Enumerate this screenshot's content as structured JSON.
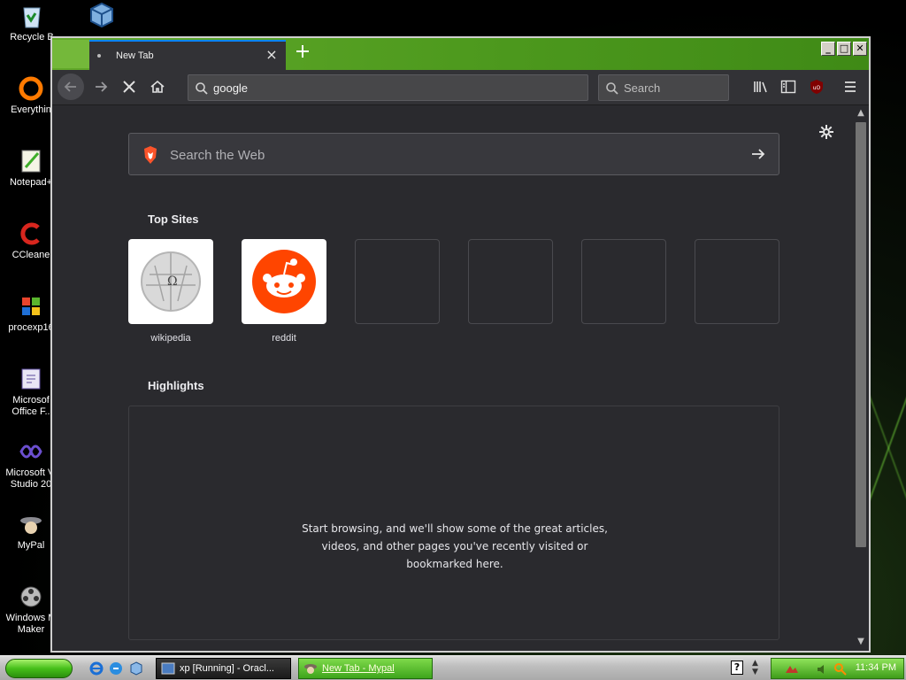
{
  "desktop": {
    "icons": [
      {
        "label": "Recycle B",
        "icon": "recycle-bin-icon"
      },
      {
        "label": "Everythin",
        "icon": "everything-icon"
      },
      {
        "label": "Notepad+",
        "icon": "notepad-plus-icon"
      },
      {
        "label": "CCleane",
        "icon": "ccleaner-icon"
      },
      {
        "label": "procexp16",
        "icon": "process-explorer-icon"
      },
      {
        "label": "Microsof Office F..",
        "icon": "office-icon"
      },
      {
        "label": "Microsoft Vi Studio 20",
        "icon": "visual-studio-icon"
      },
      {
        "label": "MyPal",
        "icon": "mypal-icon"
      },
      {
        "label": "Windows M Maker",
        "icon": "movie-maker-icon"
      }
    ]
  },
  "browser": {
    "tab": {
      "title": "New Tab"
    },
    "window_buttons": {
      "minimize": "_",
      "maximize": "□",
      "close": "✕"
    },
    "urlbar": {
      "value": "google"
    },
    "searchbar": {
      "placeholder": "Search"
    },
    "ublock_label": "uO"
  },
  "newtab": {
    "search_placeholder": "Search the Web",
    "top_sites_title": "Top Sites",
    "top_sites": [
      {
        "label": "wikipedia",
        "icon": "wikipedia-icon"
      },
      {
        "label": "reddit",
        "icon": "reddit-icon"
      },
      {
        "label": ""
      },
      {
        "label": ""
      },
      {
        "label": ""
      },
      {
        "label": ""
      }
    ],
    "highlights_title": "Highlights",
    "highlights_message_1": "Start browsing, and we'll show some of the great articles,",
    "highlights_message_2": "videos, and other pages you've recently visited or",
    "highlights_message_3": "bookmarked here."
  },
  "taskbar": {
    "tasks": [
      {
        "label": "xp [Running] - Oracl..."
      },
      {
        "label": "New Tab - Mypal"
      }
    ],
    "clock": "11:34 PM"
  },
  "colors": {
    "accent": "#0a84ff",
    "title_green": "#4e9a1e",
    "reddit": "#ff4500"
  }
}
